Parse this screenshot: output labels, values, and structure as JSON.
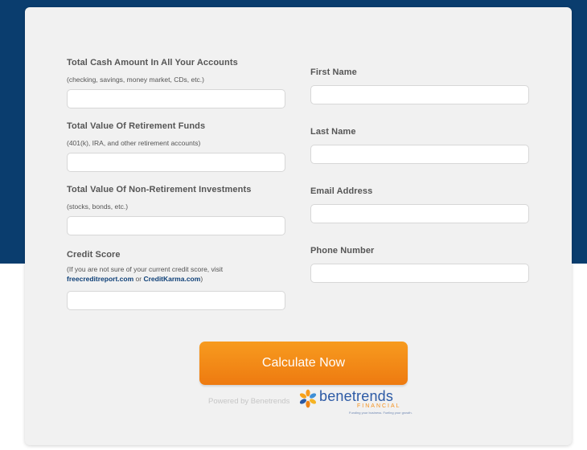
{
  "form": {
    "cash": {
      "label": "Total Cash Amount In All Your Accounts",
      "hint": "(checking, savings, money market, CDs, etc.)",
      "value": ""
    },
    "retirement": {
      "label": "Total Value Of Retirement Funds",
      "hint": "(401(k), IRA, and other retirement accounts)",
      "value": ""
    },
    "non_retirement": {
      "label": "Total Value Of Non-Retirement Investments",
      "hint": "(stocks, bonds, etc.)",
      "value": ""
    },
    "credit": {
      "label": "Credit Score",
      "hint_prefix": "(If you are not sure of your current credit score, visit",
      "link1": "freecreditreport.com",
      "hint_or": "or",
      "link2": "CreditKarma.com",
      "hint_suffix": ")",
      "value": ""
    },
    "first_name": {
      "label": "First Name",
      "value": ""
    },
    "last_name": {
      "label": "Last Name",
      "value": ""
    },
    "email": {
      "label": "Email Address",
      "value": ""
    },
    "phone": {
      "label": "Phone Number",
      "value": ""
    }
  },
  "submit": {
    "label": "Calculate Now"
  },
  "footer": {
    "powered_by": "Powered by Benetrends",
    "logo_name": "benetrends",
    "logo_sub": "FINANCIAL",
    "logo_tagline": "Funding your business. Fueling your growth."
  },
  "colors": {
    "background_blue": "#0a3d6e",
    "button_orange": "#f08414",
    "link_blue": "#0d3f77"
  }
}
